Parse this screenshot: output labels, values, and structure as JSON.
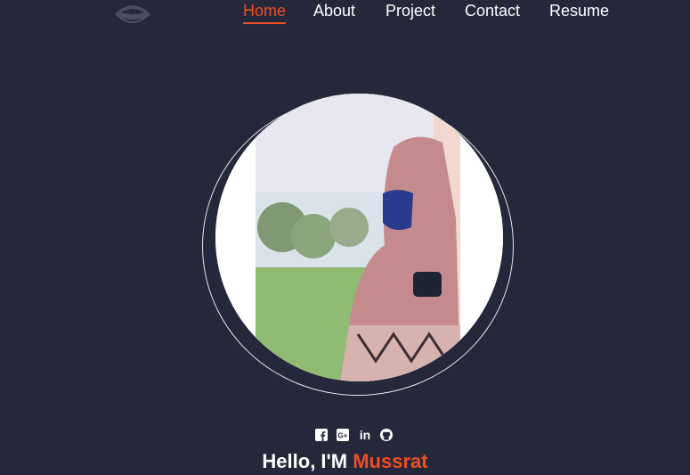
{
  "nav": {
    "logo_icon": "mask-logo-icon",
    "items": [
      {
        "label": "Home",
        "active": true
      },
      {
        "label": "About",
        "active": false
      },
      {
        "label": "Project",
        "active": false
      },
      {
        "label": "Contact",
        "active": false
      },
      {
        "label": "Resume",
        "active": false
      }
    ]
  },
  "hero": {
    "avatar_alt": "profile photo",
    "socials": [
      "facebook-icon",
      "google-plus-icon",
      "linkedin-icon",
      "github-icon"
    ],
    "greeting_prefix": "Hello, I'M",
    "greeting_name": "Mussrat"
  },
  "colors": {
    "background": "#25283b",
    "accent": "#f04e23",
    "text": "#ffffff"
  }
}
